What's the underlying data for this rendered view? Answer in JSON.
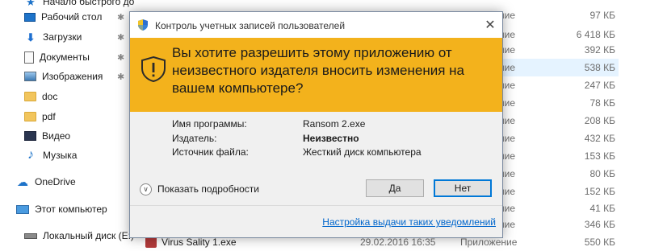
{
  "sidebar": {
    "cut_top_label": "Начало быстрого до",
    "items": [
      {
        "label": "Рабочий стол",
        "icon": "desktop-icon",
        "pinned": true
      },
      {
        "label": "Загрузки",
        "icon": "download-icon",
        "pinned": true
      },
      {
        "label": "Документы",
        "icon": "documents-icon",
        "pinned": true
      },
      {
        "label": "Изображения",
        "icon": "pictures-icon",
        "pinned": true
      },
      {
        "label": "doc",
        "icon": "folder-icon",
        "pinned": false
      },
      {
        "label": "pdf",
        "icon": "folder-icon",
        "pinned": false
      },
      {
        "label": "Видео",
        "icon": "video-icon",
        "pinned": false
      },
      {
        "label": "Музыка",
        "icon": "music-icon",
        "pinned": false
      },
      {
        "label": "OneDrive",
        "icon": "onedrive-icon",
        "pinned": false
      },
      {
        "label": "Этот компьютер",
        "icon": "computer-icon",
        "pinned": false
      },
      {
        "label": "Локальный диск (E:)",
        "icon": "disk-icon",
        "pinned": false
      }
    ]
  },
  "files": {
    "rows": [
      {
        "kind": "ние",
        "size": "97 КБ",
        "selected": false
      },
      {
        "kind": "ние",
        "size": "6 418 КБ",
        "selected": false
      },
      {
        "kind": "ние",
        "size": "392 КБ",
        "selected": false
      },
      {
        "kind": "ние",
        "size": "538 КБ",
        "selected": true
      },
      {
        "kind": "ние",
        "size": "247 КБ",
        "selected": false
      },
      {
        "kind": "ние",
        "size": "78 КБ",
        "selected": false
      },
      {
        "kind": "ние",
        "size": "208 КБ",
        "selected": false
      },
      {
        "kind": "ние",
        "size": "432 КБ",
        "selected": false
      },
      {
        "kind": "ние",
        "size": "153 КБ",
        "selected": false
      },
      {
        "kind": "ние",
        "size": "80 КБ",
        "selected": false
      },
      {
        "kind": "ние",
        "size": "152 КБ",
        "selected": false
      },
      {
        "kind": "ние",
        "size": "41 КБ",
        "selected": false
      },
      {
        "kind": "ние",
        "size": "346 КБ",
        "selected": false
      }
    ],
    "last_row": {
      "name": "Virus Sality 1.exe",
      "date": "29.02.2016 16:35",
      "kind": "Приложение",
      "size": "550 КБ"
    }
  },
  "uac": {
    "title": "Контроль учетных записей пользователей",
    "close_glyph": "✕",
    "question": "Вы хотите разрешить этому приложению от неизвестного издателя вносить изменения на вашем компьютере?",
    "banner_color": "#f3b21c",
    "program_label": "Имя программы:",
    "program_value": "Ransom 2.exe",
    "publisher_label": "Издатель:",
    "publisher_value": "Неизвестно",
    "source_label": "Источник файла:",
    "source_value": "Жесткий диск компьютера",
    "details_label": "Показать подробности",
    "yes_label": "Да",
    "no_label": "Нет",
    "settings_link": "Настройка выдачи таких уведомлений"
  }
}
